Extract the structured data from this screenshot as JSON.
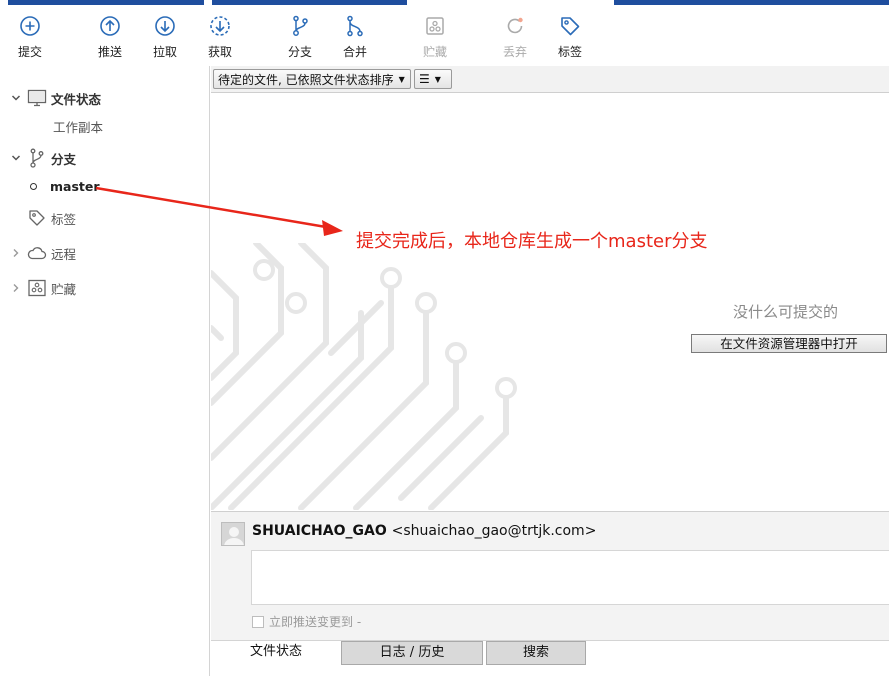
{
  "toolbar": {
    "commit": "提交",
    "push": "推送",
    "pull": "拉取",
    "fetch": "获取",
    "branch": "分支",
    "merge": "合并",
    "stash": "贮藏",
    "discard": "丢弃",
    "tag": "标签"
  },
  "sidebar": {
    "file_status": "文件状态",
    "working_copy": "工作副本",
    "branches": "分支",
    "master": "master",
    "tags": "标签",
    "remotes": "远程",
    "stashes": "贮藏"
  },
  "filter": {
    "sort_label": "待定的文件, 已依照文件状态排序",
    "view_icon": "list-icon"
  },
  "main": {
    "empty_message": "没什么可提交的",
    "open_explorer": "在文件资源管理器中打开"
  },
  "annotation": {
    "text": "提交完成后，本地仓库生成一个master分支",
    "color": "#e8261a"
  },
  "commit": {
    "author_name": "SHUAICHAO_GAO",
    "author_email": "<shuaichao_gao@trtjk.com>",
    "push_immediately": "立即推送变更到 -"
  },
  "tabs": {
    "file_status": "文件状态",
    "log_history": "日志 / 历史",
    "search": "搜索"
  },
  "colors": {
    "icon_blue": "#2b6cb8",
    "disabled": "#aaaaaa",
    "title_bar": "#1f4e9e"
  }
}
